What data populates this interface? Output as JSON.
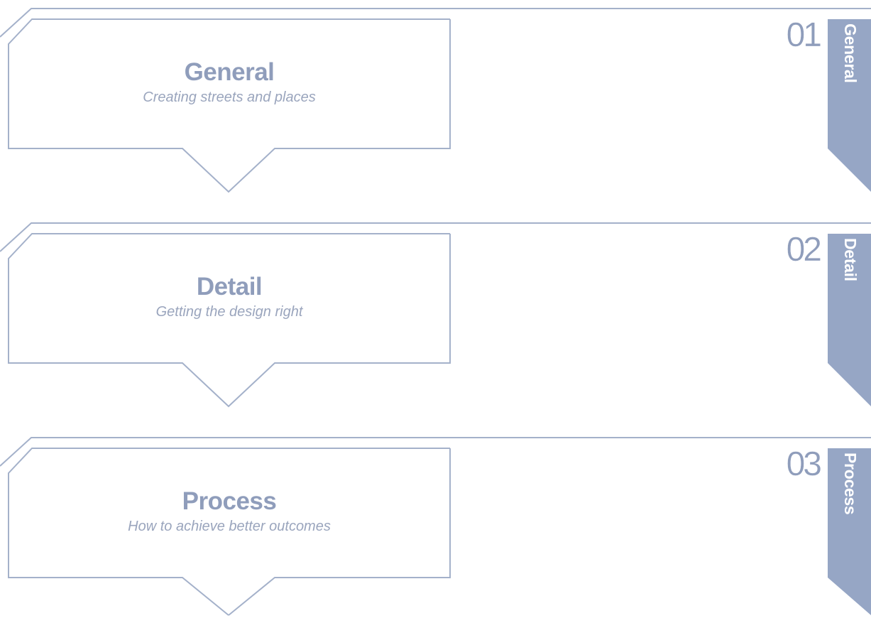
{
  "sections": [
    {
      "number": "01",
      "title": "General",
      "subtitle": "Creating streets and places",
      "tab_label": "General"
    },
    {
      "number": "02",
      "title": "Detail",
      "subtitle": "Getting the design right",
      "tab_label": "Detail"
    },
    {
      "number": "03",
      "title": "Process",
      "subtitle": "How to achieve better outcomes",
      "tab_label": "Process"
    }
  ],
  "colors": {
    "accent": "#96a6c5",
    "line": "#a4b1ca",
    "heading": "#8f9dbb",
    "subtitle": "#9aa5bd"
  }
}
